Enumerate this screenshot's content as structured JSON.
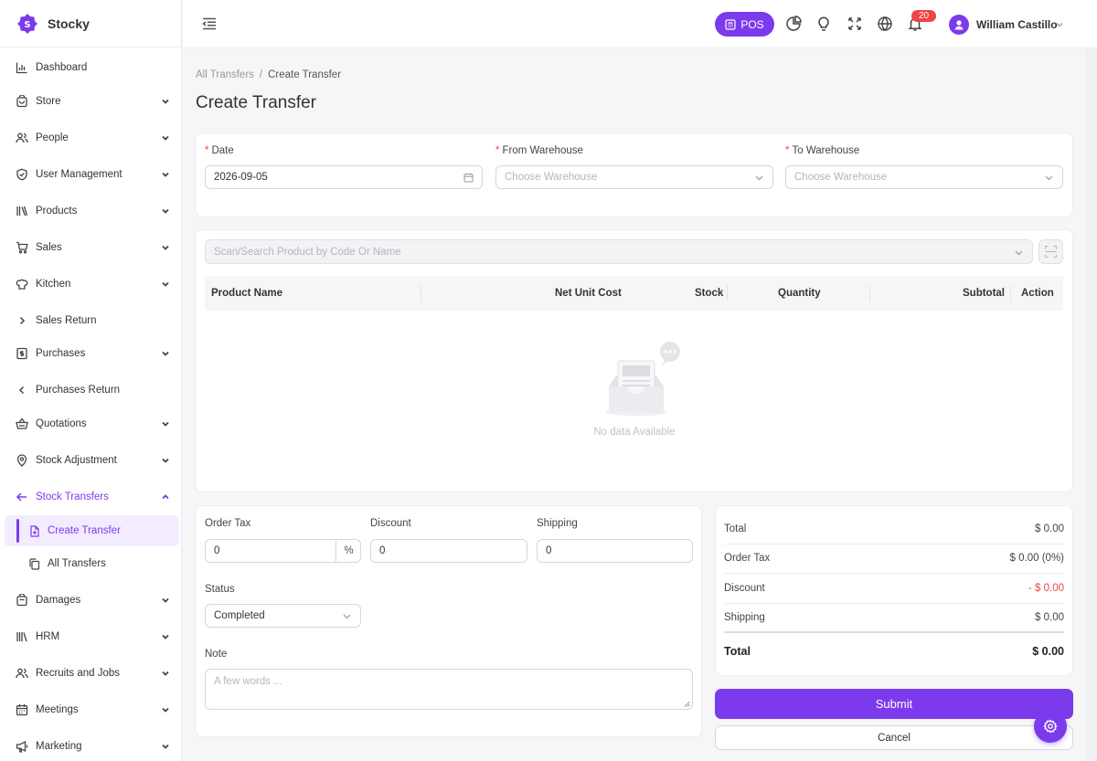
{
  "brand": {
    "name": "Stocky"
  },
  "sidebar": {
    "items": [
      {
        "label": "Dashboard",
        "icon": "chart-bar-icon",
        "chevron": "none"
      },
      {
        "label": "Store",
        "icon": "store-icon",
        "chevron": "down"
      },
      {
        "label": "People",
        "icon": "people-icon",
        "chevron": "down"
      },
      {
        "label": "User Management",
        "icon": "shield-icon",
        "chevron": "down"
      },
      {
        "label": "Products",
        "icon": "books-icon",
        "chevron": "down"
      },
      {
        "label": "Sales",
        "icon": "cart-icon",
        "chevron": "down"
      },
      {
        "label": "Kitchen",
        "icon": "chef-hat-icon",
        "chevron": "down"
      },
      {
        "label": "Sales Return",
        "icon": "chevron-right-icon",
        "chevron": "none"
      },
      {
        "label": "Purchases",
        "icon": "receipt-icon",
        "chevron": "down"
      },
      {
        "label": "Purchases Return",
        "icon": "chevron-left-icon",
        "chevron": "none"
      },
      {
        "label": "Quotations",
        "icon": "basket-icon",
        "chevron": "down"
      },
      {
        "label": "Stock Adjustment",
        "icon": "location-icon",
        "chevron": "down"
      },
      {
        "label": "Stock Transfers",
        "icon": "arrow-left-icon",
        "chevron": "up"
      }
    ],
    "sub_items": [
      {
        "label": "Create Transfer",
        "icon": "file-plus-icon"
      },
      {
        "label": "All Transfers",
        "icon": "copy-icon"
      }
    ],
    "items_after": [
      {
        "label": "Damages",
        "icon": "package-icon",
        "chevron": "down"
      },
      {
        "label": "HRM",
        "icon": "library-icon",
        "chevron": "down"
      },
      {
        "label": "Recruits and Jobs",
        "icon": "users-icon",
        "chevron": "down"
      },
      {
        "label": "Meetings",
        "icon": "calendar-icon",
        "chevron": "down"
      },
      {
        "label": "Marketing",
        "icon": "megaphone-icon",
        "chevron": "down"
      }
    ]
  },
  "header": {
    "pos_label": "POS",
    "notification_count": "20",
    "user_name": "William Castillo"
  },
  "breadcrumb": {
    "parent": "All Transfers",
    "separator": "/",
    "current": "Create Transfer"
  },
  "page_title": "Create Transfer",
  "form": {
    "date_label": "Date",
    "date_value": "2026-09-05",
    "from_label": "From Warehouse",
    "from_placeholder": "Choose Warehouse",
    "to_label": "To Warehouse",
    "to_placeholder": "Choose Warehouse",
    "required_mark": "*"
  },
  "products": {
    "search_placeholder": "Scan/Search Product by Code Or Name",
    "columns": [
      "Product Name",
      "Net Unit Cost",
      "Stock",
      "Quantity",
      "Subtotal",
      "Action"
    ],
    "empty_text": "No data Available"
  },
  "details": {
    "order_tax_label": "Order Tax",
    "order_tax_value": "0",
    "order_tax_unit": "%",
    "discount_label": "Discount",
    "discount_value": "0",
    "shipping_label": "Shipping",
    "shipping_value": "0",
    "status_label": "Status",
    "status_value": "Completed",
    "note_label": "Note",
    "note_placeholder": "A few words ..."
  },
  "summary": {
    "rows": [
      {
        "label": "Total",
        "value": "$ 0.00"
      },
      {
        "label": "Order Tax",
        "value": "$ 0.00 (0%)"
      },
      {
        "label": "Discount",
        "value": "- $ 0.00"
      },
      {
        "label": "Shipping",
        "value": "$ 0.00"
      }
    ],
    "grand_label": "Total",
    "grand_value": "$ 0.00"
  },
  "actions": {
    "submit": "Submit",
    "cancel": "Cancel"
  },
  "colors": {
    "accent": "#7c3aed",
    "danger": "#ef4444"
  }
}
